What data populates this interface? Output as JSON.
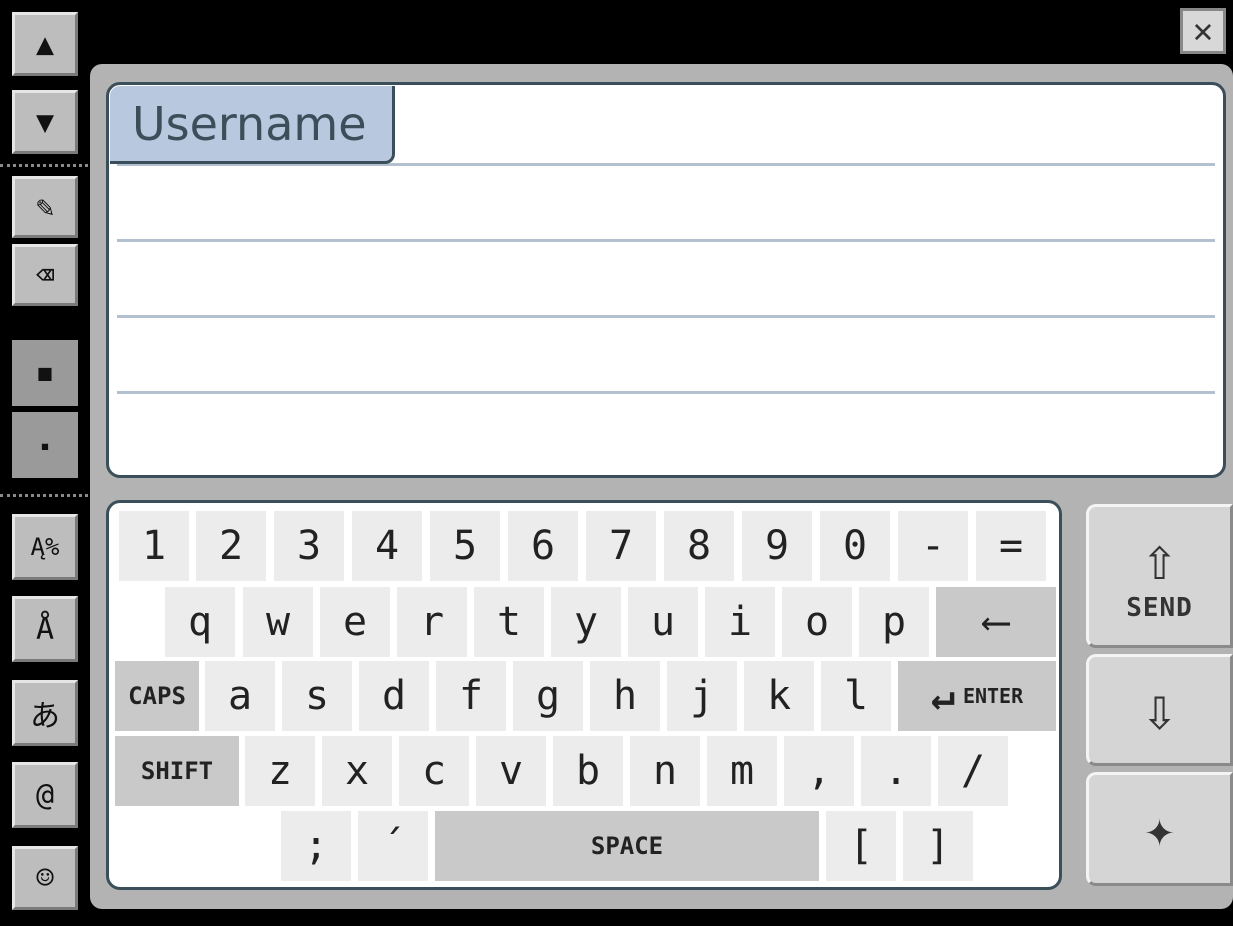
{
  "sidebar": {
    "scroll_up": "▲",
    "scroll_down": "▼",
    "pencil": "✎",
    "eraser": "⌫",
    "size_large": "■",
    "size_small": "▪",
    "symbols": "Ą%",
    "accents": "Å",
    "hiragana": "あ",
    "at": "@",
    "smiley": "☺"
  },
  "close_label": "✕",
  "note": {
    "tab_label": "Username"
  },
  "keyboard": {
    "rows": [
      [
        "1",
        "2",
        "3",
        "4",
        "5",
        "6",
        "7",
        "8",
        "9",
        "0",
        "-",
        "="
      ],
      [
        "q",
        "w",
        "e",
        "r",
        "t",
        "y",
        "u",
        "i",
        "o",
        "p"
      ],
      [
        "a",
        "s",
        "d",
        "f",
        "g",
        "h",
        "j",
        "k",
        "l"
      ],
      [
        "z",
        "x",
        "c",
        "v",
        "b",
        "n",
        "m",
        ",",
        ".",
        "/"
      ],
      [
        ";",
        "´"
      ]
    ],
    "backspace": "⟵",
    "caps": "CAPS",
    "enter": "ENTER",
    "enter_icon": "↵",
    "shift": "SHIFT",
    "space": "SPACE",
    "bracket_open": "[",
    "bracket_close": "]"
  },
  "actions": {
    "send_label": "SEND",
    "send_icon": "⇧",
    "receive_icon": "⇩",
    "connect_icon": "✦"
  }
}
